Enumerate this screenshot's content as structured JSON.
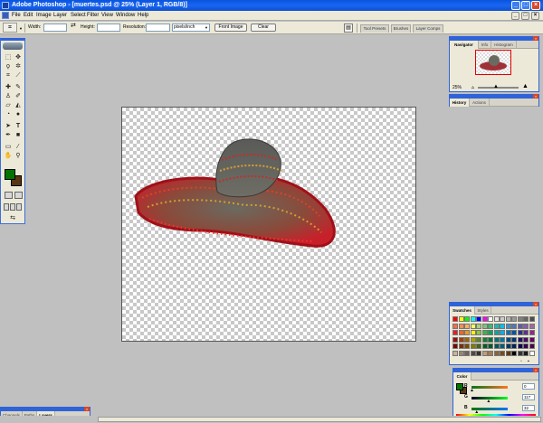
{
  "titlebar": {
    "title": "Adobe Photoshop - [muertes.psd @ 25% (Layer 1, RGB/8)]",
    "min": "_",
    "max": "□",
    "close": "×"
  },
  "menubar": {
    "items": [
      "File",
      "Edit",
      "Image",
      "Layer",
      "Select",
      "Filter",
      "View",
      "Window",
      "Help"
    ]
  },
  "options": {
    "width_label": "Width:",
    "width_value": "",
    "swap_icon": "⇄",
    "height_label": "Height:",
    "height_value": "",
    "resolution_label": "Resolution:",
    "resolution_value": "",
    "unit_value": "pixels/inch",
    "front_image_label": "Front Image",
    "clear_label": "Clear"
  },
  "palette_well": {
    "tabs": [
      "Tool Presets",
      "Brushes",
      "Layer Comps"
    ]
  },
  "toolbox": {
    "fg_color": "#017501",
    "bg_color": "#5a3512"
  },
  "navigator": {
    "tabs": [
      "Navigator",
      "Info",
      "Histogram"
    ],
    "zoom": "25%"
  },
  "history": {
    "tabs": [
      "History",
      "Actions"
    ]
  },
  "swatches": {
    "tabs": [
      "Swatches",
      "Styles"
    ]
  },
  "color_panel": {
    "tabs": [
      "Color"
    ],
    "channels": [
      {
        "label": "R",
        "value": "0",
        "level": 0
      },
      {
        "label": "G",
        "value": "117",
        "level": 0.46
      },
      {
        "label": "B",
        "value": "32",
        "level": 0.13
      }
    ]
  },
  "layers_dock": {
    "tabs": [
      "Channels",
      "Paths",
      "Layers"
    ]
  }
}
